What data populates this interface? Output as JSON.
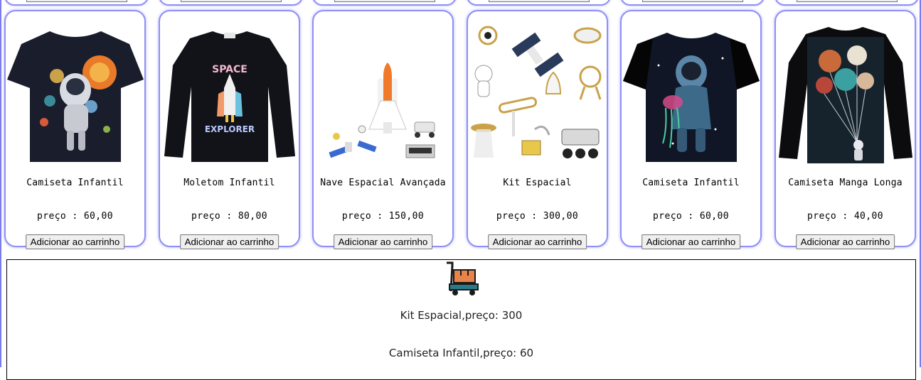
{
  "products": [
    {
      "name": "Camiseta Infantil",
      "price_label": "preço : 60,00",
      "button_label": "Adicionar ao carrinho",
      "icon": "astronaut-tshirt-image"
    },
    {
      "name": "Moletom Infantil",
      "price_label": "preço : 80,00",
      "button_label": "Adicionar ao carrinho",
      "icon": "space-explorer-sweatshirt-image"
    },
    {
      "name": "Nave Espacial Avançada",
      "price_label": "preço : 150,00",
      "button_label": "Adicionar ao carrinho",
      "icon": "space-shuttle-toy-image"
    },
    {
      "name": "Kit Espacial",
      "price_label": "preço : 300,00",
      "button_label": "Adicionar ao carrinho",
      "icon": "space-kit-toys-image"
    },
    {
      "name": "Camiseta Infantil",
      "price_label": "preço : 60,00",
      "button_label": "Adicionar ao carrinho",
      "icon": "astronaut-jellyfish-tshirt-image"
    },
    {
      "name": "Camiseta Manga Longa",
      "price_label": "preço : 40,00",
      "button_label": "Adicionar ao carrinho",
      "icon": "astronaut-balloons-longsleeve-image"
    }
  ],
  "cart": {
    "icon": "shopping-cart-icon",
    "items": [
      "Kit Espacial,preço: 300",
      "Camiseta Infantil,preço: 60"
    ]
  },
  "colors": {
    "card_border": "#8f8ff5",
    "cart_teal": "#2a7a8a",
    "cart_orange": "#e8834a"
  }
}
